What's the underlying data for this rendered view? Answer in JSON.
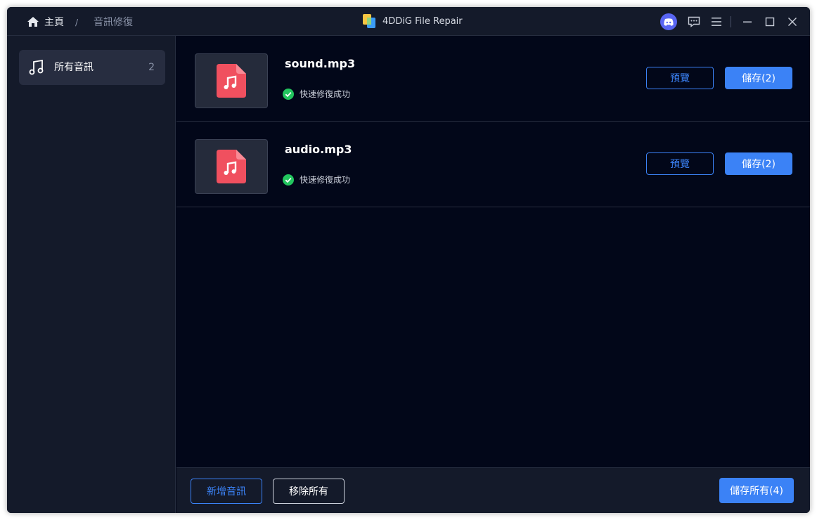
{
  "titlebar": {
    "breadcrumb_home": "主頁",
    "breadcrumb_separator": "/",
    "breadcrumb_current": "音訊修復",
    "app_title": "4DDiG File Repair",
    "icons": [
      "home-icon",
      "app-logo-icon",
      "discord-icon",
      "feedback-icon",
      "menu-icon",
      "minimize-icon",
      "maximize-icon",
      "close-icon"
    ]
  },
  "sidebar": {
    "items": [
      {
        "label": "所有音訊",
        "count": "2",
        "icon": "music-note-icon"
      }
    ]
  },
  "files": [
    {
      "name": "sound.mp3",
      "status": "快速修復成功",
      "preview_label": "預覽",
      "save_label": "儲存(2)"
    },
    {
      "name": "audio.mp3",
      "status": "快速修復成功",
      "preview_label": "預覽",
      "save_label": "儲存(2)"
    }
  ],
  "footer": {
    "add_label": "新增音訊",
    "remove_all_label": "移除所有",
    "save_all_label": "儲存所有(4)"
  },
  "colors": {
    "accent": "#3b82f6",
    "background": "#020719",
    "panel": "#141a2a",
    "success": "#22c55e",
    "file_icon": "#f0505f"
  }
}
